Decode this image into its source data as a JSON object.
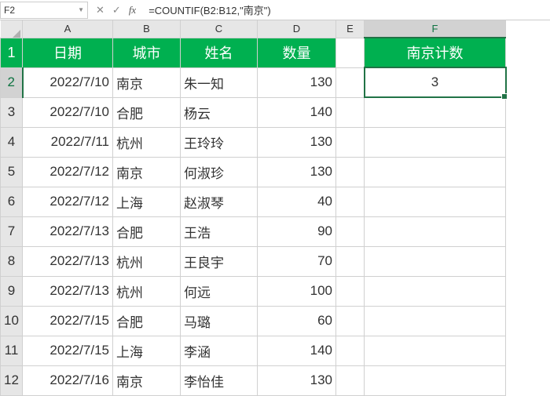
{
  "namebox": {
    "cellref": "F2",
    "dropdown": "▼"
  },
  "formula_bar": {
    "cancel": "✕",
    "confirm": "✓",
    "fx": "fx",
    "formula": "=COUNTIF(B2:B12,\"南京\")"
  },
  "columns": [
    "A",
    "B",
    "C",
    "D",
    "E",
    "F"
  ],
  "row_numbers": [
    "1",
    "2",
    "3",
    "4",
    "5",
    "6",
    "7",
    "8",
    "9",
    "10",
    "11",
    "12"
  ],
  "headers": {
    "A": "日期",
    "B": "城市",
    "C": "姓名",
    "D": "数量",
    "F": "南京计数"
  },
  "rows": [
    {
      "date": "2022/7/10",
      "city": "南京",
      "name": "朱一知",
      "qty": "130"
    },
    {
      "date": "2022/7/10",
      "city": "合肥",
      "name": "杨云",
      "qty": "140"
    },
    {
      "date": "2022/7/11",
      "city": "杭州",
      "name": "王玲玲",
      "qty": "130"
    },
    {
      "date": "2022/7/12",
      "city": "南京",
      "name": "何淑珍",
      "qty": "130"
    },
    {
      "date": "2022/7/12",
      "city": "上海",
      "name": "赵淑琴",
      "qty": "40"
    },
    {
      "date": "2022/7/13",
      "city": "合肥",
      "name": "王浩",
      "qty": "90"
    },
    {
      "date": "2022/7/13",
      "city": "杭州",
      "name": "王良宇",
      "qty": "70"
    },
    {
      "date": "2022/7/13",
      "city": "杭州",
      "name": "何远",
      "qty": "100"
    },
    {
      "date": "2022/7/15",
      "city": "合肥",
      "name": "马璐",
      "qty": "60"
    },
    {
      "date": "2022/7/15",
      "city": "上海",
      "name": "李涵",
      "qty": "140"
    },
    {
      "date": "2022/7/16",
      "city": "南京",
      "name": "李怡佳",
      "qty": "130"
    }
  ],
  "result": {
    "F2": "3"
  },
  "selected": {
    "cell": "F2",
    "row": 2,
    "col": "F"
  }
}
